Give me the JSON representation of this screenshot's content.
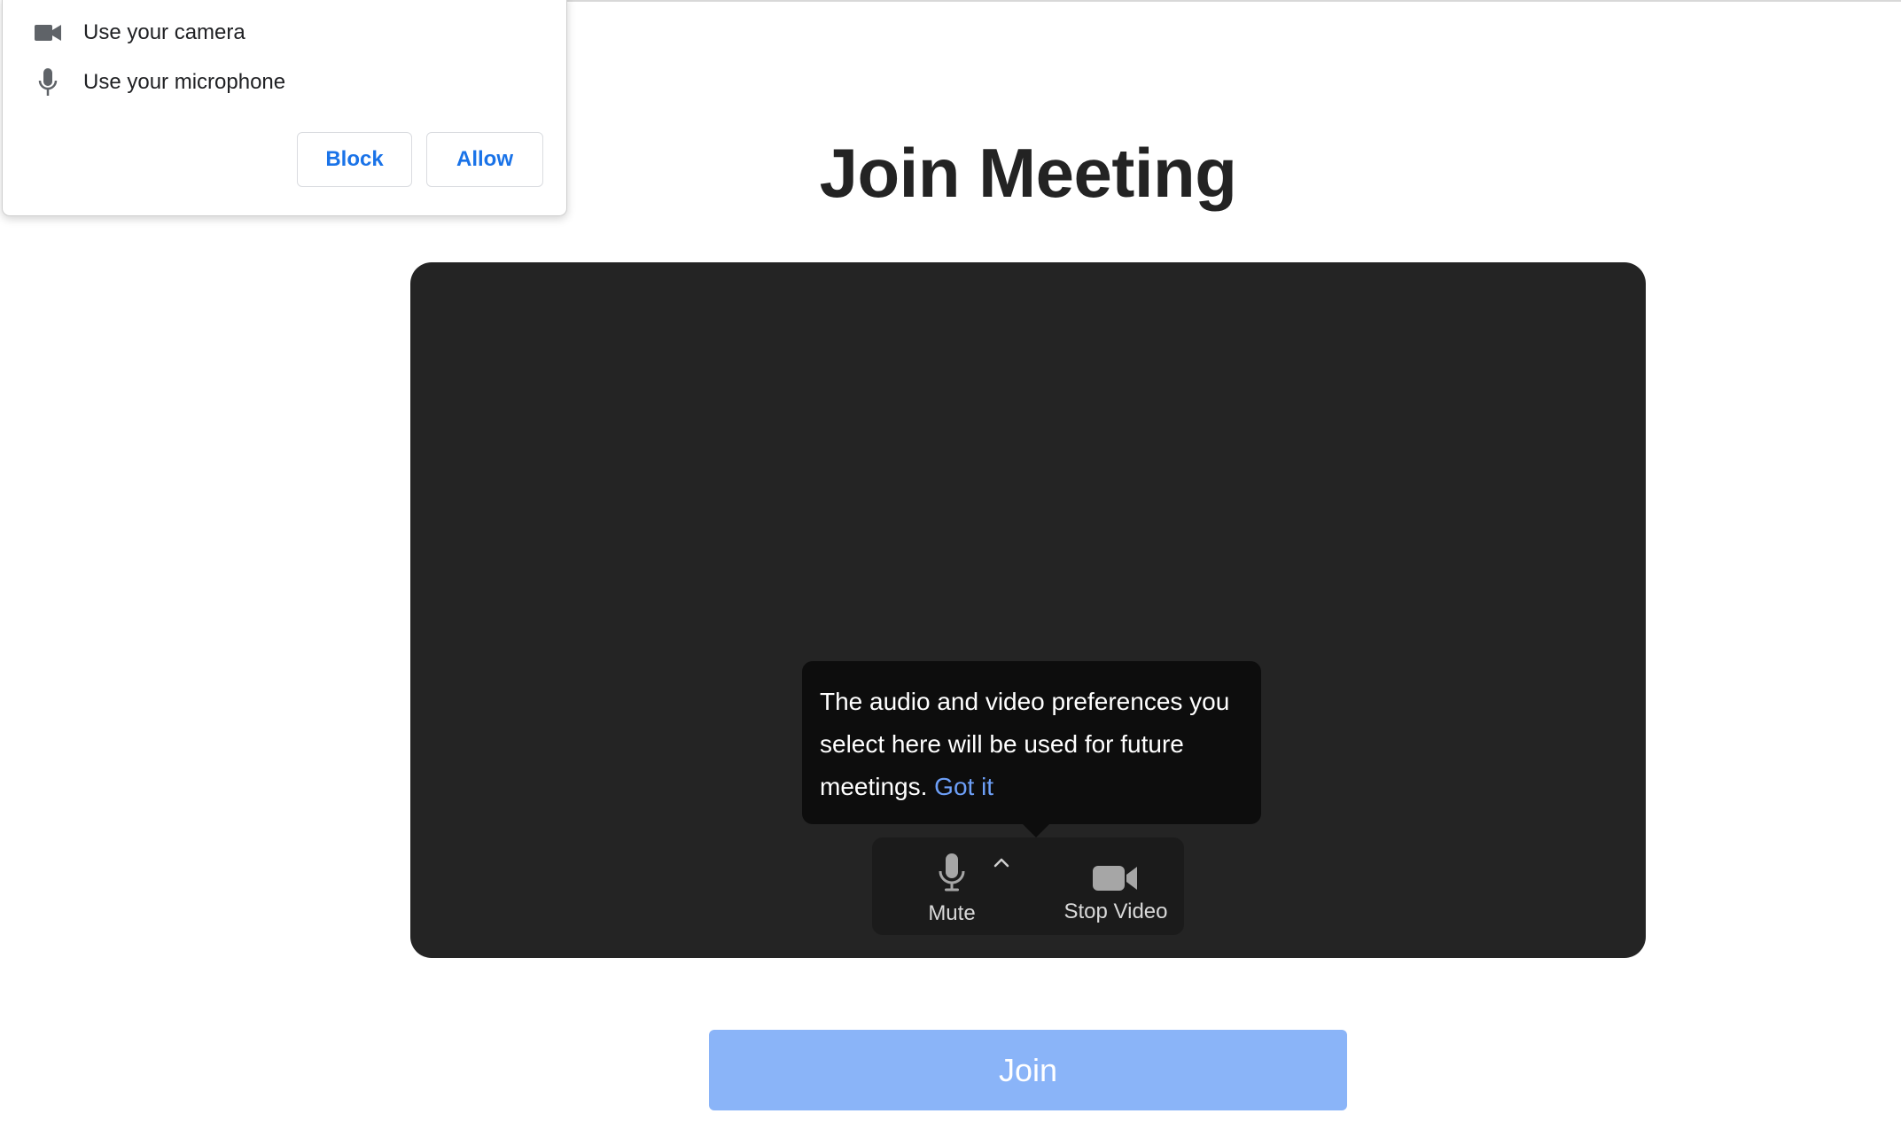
{
  "permission_popup": {
    "items": [
      {
        "icon": "video-camera-icon",
        "label": "Use your camera"
      },
      {
        "icon": "microphone-icon",
        "label": "Use your microphone"
      }
    ],
    "block_label": "Block",
    "allow_label": "Allow"
  },
  "page": {
    "title": "Join Meeting"
  },
  "preview": {
    "tooltip_text": "The audio and video preferences you select here will be used for future meetings.",
    "tooltip_link": "Got it",
    "controls": {
      "mute_label": "Mute",
      "mute_icon": "microphone-icon",
      "options_icon": "caret-up-icon",
      "video_label": "Stop Video",
      "video_icon": "video-camera-icon"
    }
  },
  "join": {
    "label": "Join"
  },
  "colors": {
    "link_blue": "#1a73e8",
    "tooltip_link": "#6d9ff7",
    "join_button": "#8ab4f8",
    "preview_bg": "#242424"
  }
}
